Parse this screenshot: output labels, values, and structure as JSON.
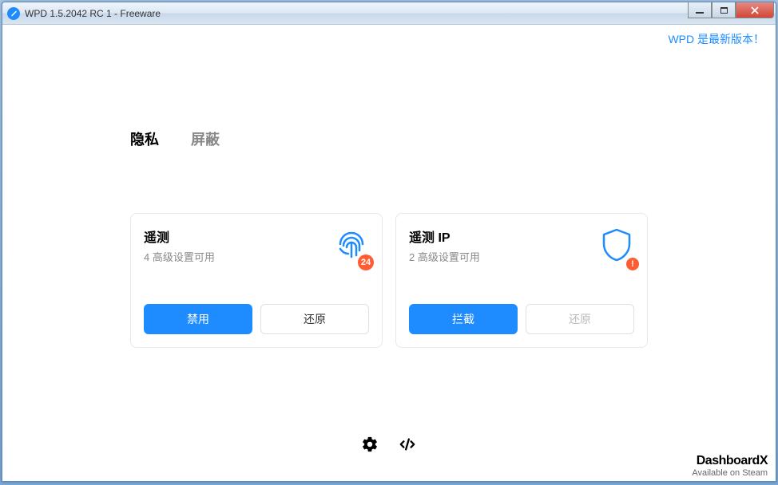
{
  "titlebar": {
    "title": "WPD 1.5.2042 RC 1 - Freeware"
  },
  "header": {
    "update_link": "WPD 是最新版本！"
  },
  "tabs": {
    "privacy": "隐私",
    "block": "屏蔽"
  },
  "cards": {
    "telemetry": {
      "title": "遥测",
      "subtitle": "4 高级设置可用",
      "badge": "24",
      "btn_primary": "禁用",
      "btn_secondary": "还原"
    },
    "telemetry_ip": {
      "title": "遥测 IP",
      "subtitle": "2 高级设置可用",
      "badge": "!",
      "btn_primary": "拦截",
      "btn_secondary": "还原"
    }
  },
  "footer": {
    "brand": "DashboardX",
    "brand_sub": "Available on Steam"
  }
}
